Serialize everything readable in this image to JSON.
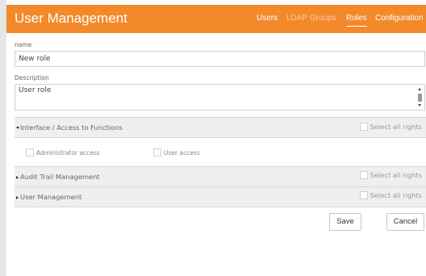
{
  "header": {
    "title": "User Management",
    "nav": [
      "Users",
      "LDAP Groups",
      "Roles",
      "Configuration"
    ],
    "active_nav": "Roles"
  },
  "form": {
    "name_label": "name",
    "name_value": "New role",
    "description_label": "Description",
    "description_value": "User role"
  },
  "sections": [
    {
      "title": "Interface / Access to Functions",
      "expanded": true,
      "select_all": "Select all rights",
      "options": [
        "Administrator access",
        "User access"
      ]
    },
    {
      "title": "Audit Trail Management",
      "expanded": false,
      "select_all": "Select all rights"
    },
    {
      "title": "User Management",
      "expanded": false,
      "select_all": "Select all rights"
    }
  ],
  "buttons": {
    "save": "Save",
    "cancel": "Cancel"
  }
}
